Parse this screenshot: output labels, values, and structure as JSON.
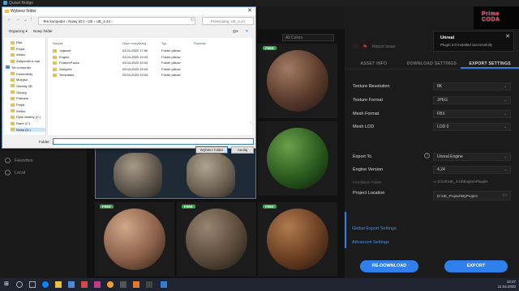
{
  "app": {
    "title": "Quixel Bridge"
  },
  "sidebar": {
    "items": [
      {
        "label": "Favorites",
        "icon": "star-icon"
      },
      {
        "label": "Local",
        "icon": "monitor-icon"
      }
    ]
  },
  "grid": {
    "filter_label": "All Colors",
    "tiles": [
      {
        "badge": "FREE",
        "color": "#6b4a3a",
        "shape": "sphere"
      },
      {
        "badge": "",
        "color": "#2f5a22",
        "shape": "sphere"
      },
      {
        "badge": "",
        "color": "#6a6258",
        "shape": "rock"
      },
      {
        "badge": "",
        "color": "#7a6d5f",
        "shape": "rock"
      },
      {
        "badge": "",
        "color": "#6e6a62",
        "shape": "sphere"
      },
      {
        "badge": "FREE",
        "color": "#b08466",
        "shape": "sphere"
      },
      {
        "badge": "FREE",
        "color": "#6a5848",
        "shape": "sphere"
      },
      {
        "badge": "FREE",
        "color": "#7a4e30",
        "shape": "sphere"
      }
    ]
  },
  "asset": {
    "action": "Report Issue"
  },
  "tabs": [
    {
      "label": "ASSET INFO"
    },
    {
      "label": "DOWNLOAD SETTINGS"
    },
    {
      "label": "EXPORT SETTINGS"
    }
  ],
  "settings": {
    "texture_resolution": {
      "label": "Texture Resolution",
      "value": "8K"
    },
    "texture_format": {
      "label": "Texture Format",
      "value": "JPEG"
    },
    "mesh_format": {
      "label": "Mesh Format",
      "value": "FBX"
    },
    "mesh_lod": {
      "label": "Mesh LOD",
      "value": "LOD 0"
    },
    "export_to": {
      "label": "Export To",
      "value": "Unreal Engine"
    },
    "engine_version": {
      "label": "Engine Version",
      "value": "4.24"
    },
    "installation_folder": {
      "label": "Installation Folder",
      "value": "D:\\UE\\UE_4.24\\Engine\\Plugins"
    },
    "project_location": {
      "label": "Project Location",
      "value": "D:\\UE_Project\\MyProject"
    }
  },
  "links": {
    "global": "Global Export Settings",
    "advanced": "Advanced Settings"
  },
  "buttons": {
    "redownload": "RE-DOWNLOAD",
    "export": "EXPORT"
  },
  "notification": {
    "title": "Unreal",
    "message": "Plugin 3.0 installed Successfully"
  },
  "corner_logo": "Prime CODA",
  "taskbar": {
    "time": "18:37",
    "date": "11.04.2020"
  },
  "dialog": {
    "title": "Wybierz folder",
    "address": "Ten komputer  ›  Nowy (D:)  ›  UE  ›  UE_4.24  ›",
    "search_placeholder": "Przeszukaj: UE_4.24",
    "organize": "Organizuj ▾",
    "new_folder": "Nowy folder",
    "columns": [
      "Nazwa",
      "Data modyfikacji",
      "Typ",
      "Rozmiar"
    ],
    "tree": [
      {
        "label": "Pliki",
        "kind": "folder"
      },
      {
        "label": "Pulpit",
        "kind": "folder"
      },
      {
        "label": "Wideo",
        "kind": "folder"
      },
      {
        "label": "Załączniki e-mai",
        "kind": "folder"
      },
      {
        "label": "Ten komputer",
        "kind": "pc"
      },
      {
        "label": "Dokumenty",
        "kind": "folder"
      },
      {
        "label": "Muzyka",
        "kind": "folder"
      },
      {
        "label": "Obiekty 3D",
        "kind": "folder"
      },
      {
        "label": "Obrazy",
        "kind": "folder"
      },
      {
        "label": "Pobrane",
        "kind": "folder"
      },
      {
        "label": "Pulpit",
        "kind": "folder"
      },
      {
        "label": "Wideo",
        "kind": "folder"
      },
      {
        "label": "Dysk lokalny (C:)",
        "kind": "folder"
      },
      {
        "label": "Dane (C:)",
        "kind": "folder"
      },
      {
        "label": "Nowy (D:)",
        "kind": "folder",
        "selected": true
      }
    ],
    "files": [
      {
        "name": ".egstore",
        "date": "03.04.2020 17:50",
        "type": "Folder plików"
      },
      {
        "name": "Engine",
        "date": "03.04.2020 19:03",
        "type": "Folder plików"
      },
      {
        "name": "FeaturePacks",
        "date": "03.04.2020 19:04",
        "type": "Folder plików"
      },
      {
        "name": "Samples",
        "date": "03.04.2020 19:04",
        "type": "Folder plików"
      },
      {
        "name": "Templates",
        "date": "03.04.2020 19:04",
        "type": "Folder plików"
      }
    ],
    "folder_label": "Folder:",
    "folder_value": "",
    "select_button": "Wybierz folder",
    "cancel_button": "Anuluj"
  }
}
